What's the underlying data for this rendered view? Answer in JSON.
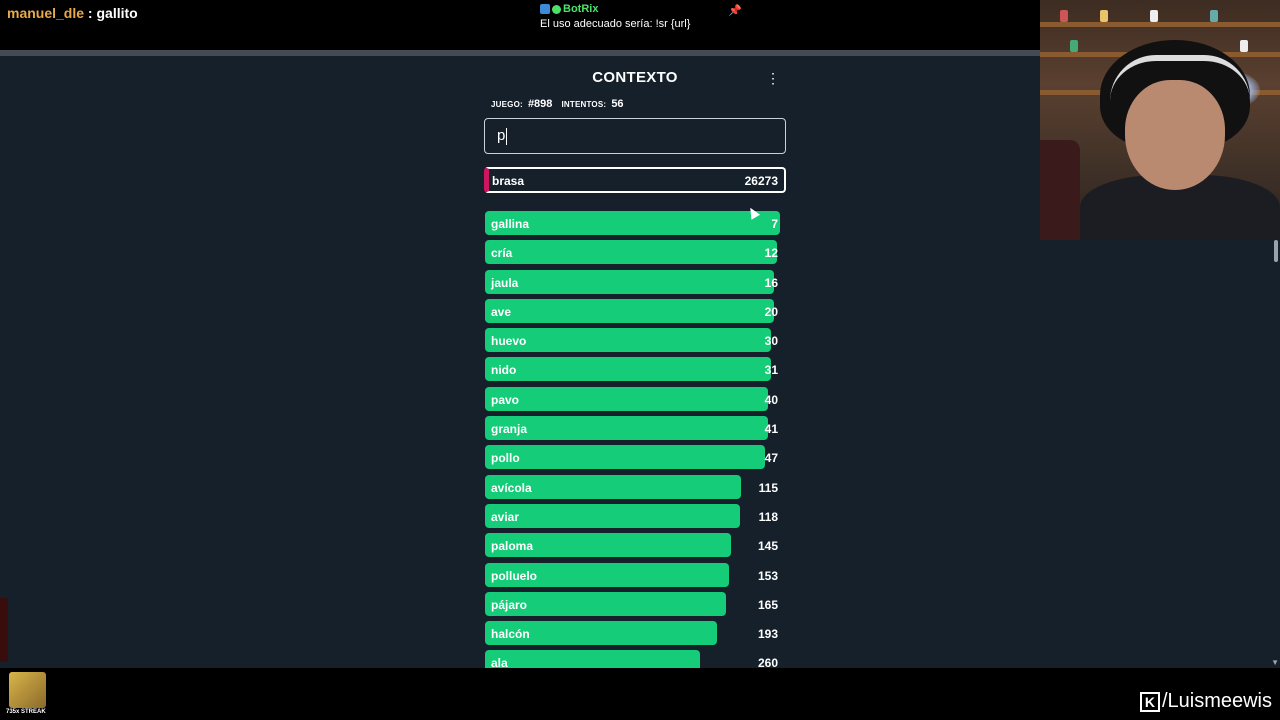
{
  "chat": {
    "user": "manuel_dle",
    "separator": " : ",
    "message": "gallito",
    "bot_name": "BotRix",
    "bot_message": "El uso adecuado sería: !sr {url}"
  },
  "game": {
    "title": "CONTEXTO",
    "game_label": "JUEGO:",
    "game_number": "#898",
    "attempts_label": "INTENTOS:",
    "attempts": "56",
    "input_value": "p",
    "last_guess": {
      "word": "brasa",
      "rank": "26273"
    },
    "guesses": [
      {
        "word": "gallina",
        "rank": "7",
        "fill": 0.99
      },
      {
        "word": "cría",
        "rank": "12",
        "fill": 0.98
      },
      {
        "word": "jaula",
        "rank": "16",
        "fill": 0.97
      },
      {
        "word": "ave",
        "rank": "20",
        "fill": 0.97
      },
      {
        "word": "huevo",
        "rank": "30",
        "fill": 0.96
      },
      {
        "word": "nido",
        "rank": "31",
        "fill": 0.96
      },
      {
        "word": "pavo",
        "rank": "40",
        "fill": 0.95
      },
      {
        "word": "granja",
        "rank": "41",
        "fill": 0.95
      },
      {
        "word": "pollo",
        "rank": "47",
        "fill": 0.94
      },
      {
        "word": "avícola",
        "rank": "115",
        "fill": 0.86
      },
      {
        "word": "aviar",
        "rank": "118",
        "fill": 0.855
      },
      {
        "word": "paloma",
        "rank": "145",
        "fill": 0.825
      },
      {
        "word": "polluelo",
        "rank": "153",
        "fill": 0.82
      },
      {
        "word": "pájaro",
        "rank": "165",
        "fill": 0.81
      },
      {
        "word": "halcón",
        "rank": "193",
        "fill": 0.78
      },
      {
        "word": "ala",
        "rank": "260",
        "fill": 0.72
      }
    ],
    "bar_color": "#15cc78",
    "last_guess_accent": "#d0145f"
  },
  "footer": {
    "streak_label": "735x STREAK",
    "channel": "/Luismeewis",
    "channel_logo": "K"
  }
}
